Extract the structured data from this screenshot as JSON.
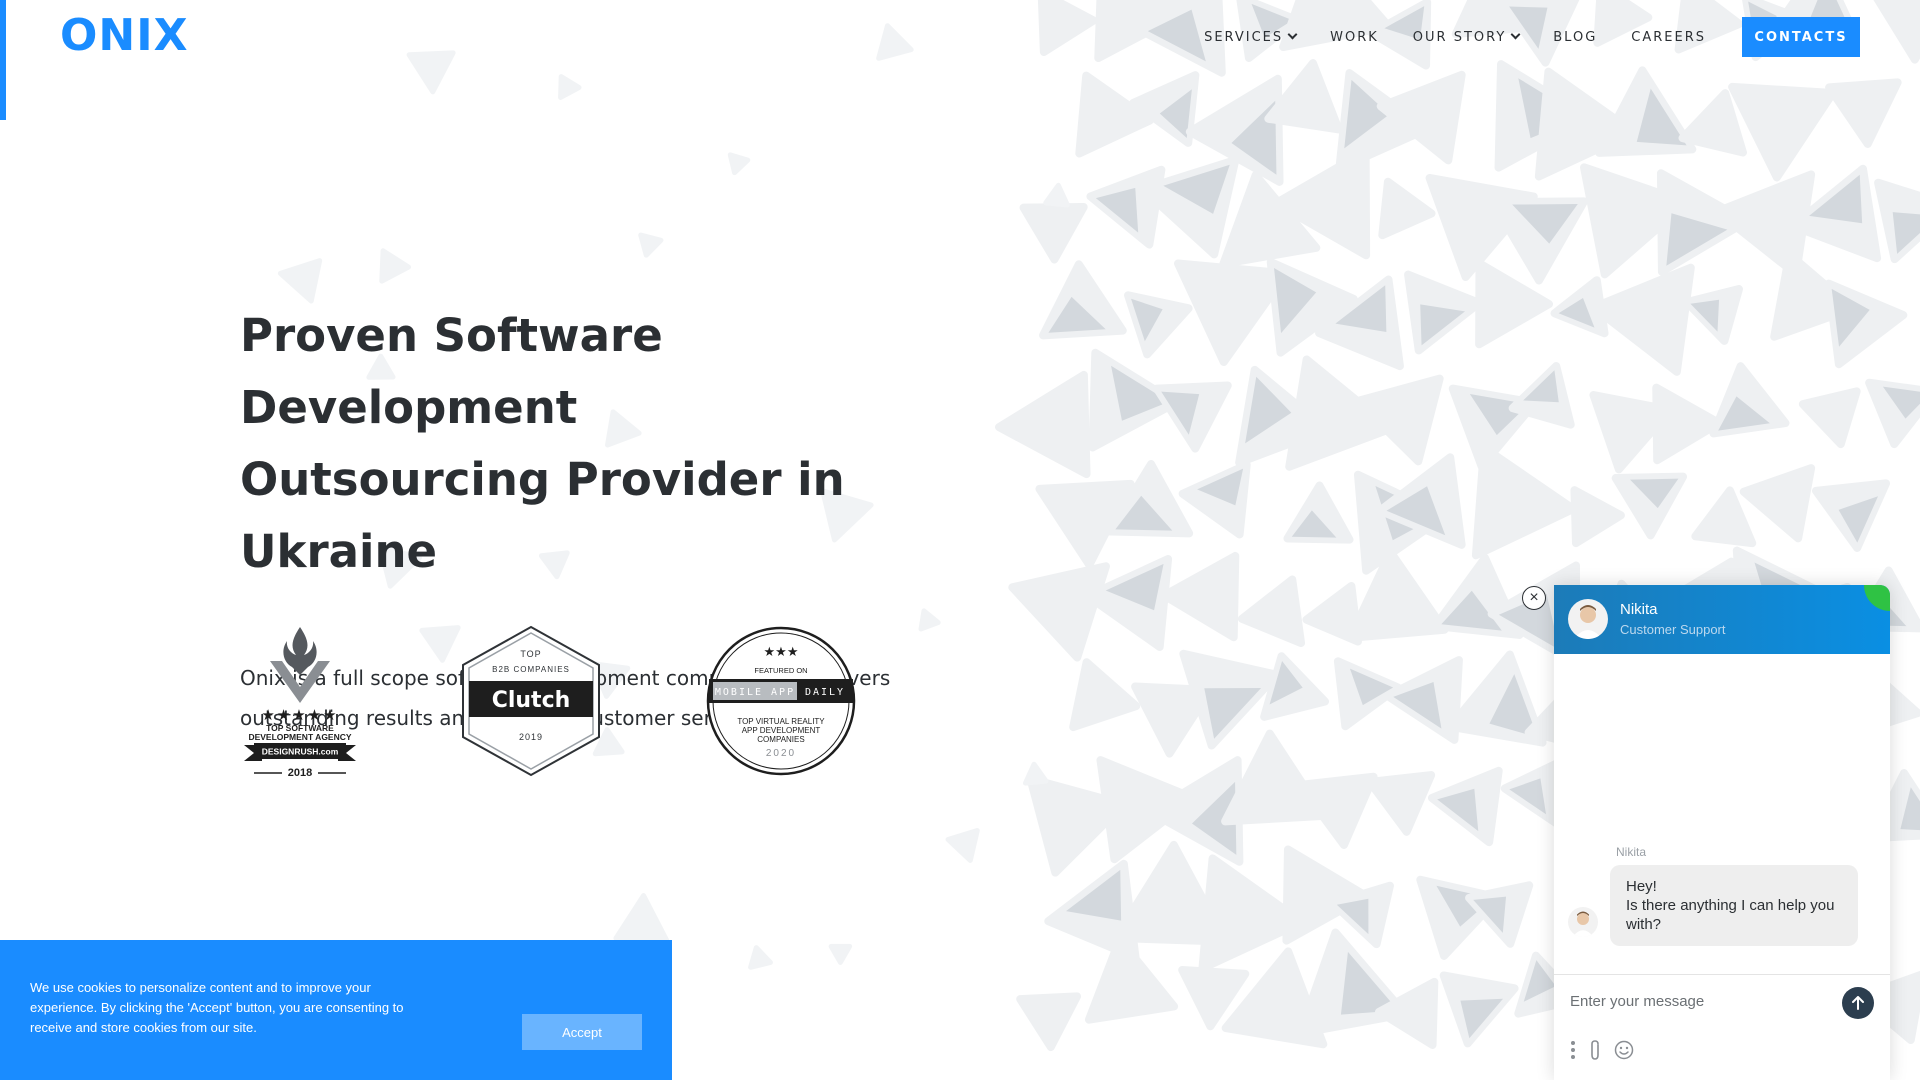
{
  "brand": {
    "logo_text": "ONIX",
    "accent_color": "#1a8cff"
  },
  "nav": {
    "items": [
      {
        "label": "SERVICES",
        "has_dropdown": true
      },
      {
        "label": "WORK",
        "has_dropdown": false
      },
      {
        "label": "OUR STORY",
        "has_dropdown": true
      },
      {
        "label": "BLOG",
        "has_dropdown": false
      },
      {
        "label": "CAREERS",
        "has_dropdown": false
      }
    ],
    "contacts_label": "CONTACTS"
  },
  "hero": {
    "title_line1": "Proven Software Development",
    "title_line2": "Outsourcing Provider in Ukraine",
    "description": "Onix is a full scope software development company that delivers outstanding results and excellent customer service."
  },
  "badges": {
    "designrush": {
      "stars": "★★★★★",
      "line1": "TOP SOFTWARE",
      "line2": "DEVELOPMENT AGENCY",
      "source": "DESIGNRUSH.com",
      "year": "2018"
    },
    "clutch": {
      "top": "TOP",
      "category": "B2B COMPANIES",
      "brand": "Clutch",
      "year": "2019"
    },
    "mobileappdaily": {
      "stars": "★★★",
      "featured": "FEATURED ON",
      "brand_left": "MOBILE APP",
      "brand_right": "DAILY",
      "line1": "TOP VIRTUAL REALITY",
      "line2": "APP DEVELOPMENT",
      "line3": "COMPANIES",
      "year": "2020"
    }
  },
  "cookie": {
    "text": "We use cookies to personalize content and to improve your experience. By clicking the 'Accept' button, you are consenting to receive and store cookies from our site.",
    "accept_label": "Accept"
  },
  "chat": {
    "agent_name": "Nikita",
    "agent_role": "Customer Support",
    "message_sender": "Nikita",
    "message_line1": "Hey!",
    "message_line2": "Is there anything I can help you with?",
    "input_placeholder": "Enter your message",
    "online_color": "#2fc244"
  }
}
